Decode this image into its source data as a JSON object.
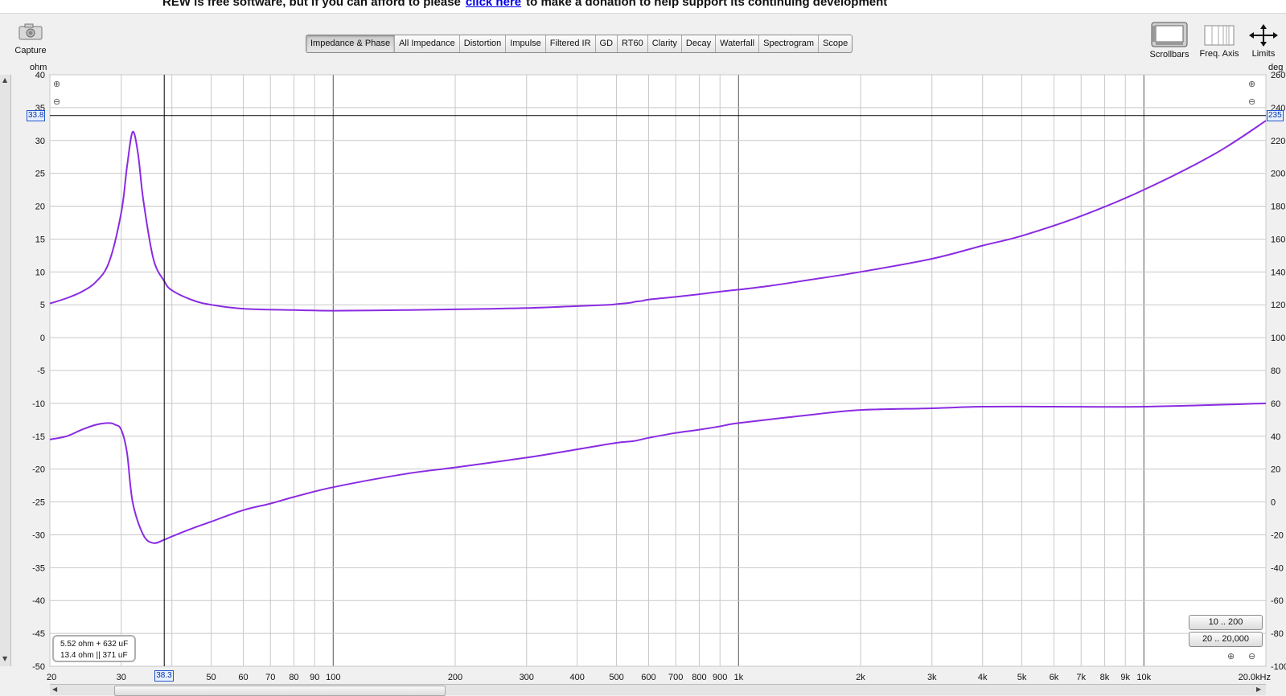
{
  "banner": {
    "prefix": "REW is free software, but if you can afford to please",
    "link": "click here",
    "suffix": "to make a donation to help support its continuing development"
  },
  "toolbar": {
    "capture_label": "Capture",
    "scrollbars_label": "Scrollbars",
    "freq_axis_label": "Freq. Axis",
    "limits_label": "Limits"
  },
  "tabs": [
    {
      "label": "Impedance & Phase",
      "active": true
    },
    {
      "label": "All Impedance"
    },
    {
      "label": "Distortion"
    },
    {
      "label": "Impulse"
    },
    {
      "label": "Filtered IR"
    },
    {
      "label": "GD"
    },
    {
      "label": "RT60"
    },
    {
      "label": "Clarity"
    },
    {
      "label": "Decay"
    },
    {
      "label": "Waterfall"
    },
    {
      "label": "Spectrogram"
    },
    {
      "label": "Scope"
    }
  ],
  "axes": {
    "left_unit": "ohm",
    "right_unit": "deg",
    "left_ticks": [
      "40",
      "35",
      "30",
      "25",
      "20",
      "15",
      "10",
      "5",
      "0",
      "-5",
      "-10",
      "-15",
      "-20",
      "-25",
      "-30",
      "-35",
      "-40",
      "-45",
      "-50"
    ],
    "right_ticks": [
      "260",
      "240",
      "220",
      "200",
      "180",
      "160",
      "140",
      "120",
      "100",
      "80",
      "60",
      "40",
      "20",
      "0",
      "-20",
      "-40",
      "-60",
      "-80",
      "-100"
    ],
    "freq_ticks": [
      "20",
      "30",
      "50",
      "60",
      "70",
      "80",
      "90",
      "100",
      "200",
      "300",
      "400",
      "500",
      "600",
      "700",
      "800",
      "900",
      "1k",
      "2k",
      "3k",
      "4k",
      "5k",
      "6k",
      "7k",
      "8k",
      "9k",
      "10k",
      "20.0kHz"
    ]
  },
  "cursor": {
    "freq_label": "38.3",
    "left_value_label": "33.8",
    "right_value_label": "235"
  },
  "legend": {
    "line1": "5.52 ohm + 632 uF",
    "line2": "13.4 ohm || 371 uF"
  },
  "range_buttons": {
    "low": "10 .. 200",
    "high": "20 .. 20,000"
  },
  "colors": {
    "trace": "#8a2be2",
    "grid": "#c8c8c8",
    "cursor": "#000000"
  },
  "chart_data": {
    "type": "line",
    "x_scale": "log",
    "xlim": [
      20,
      20000
    ],
    "ylim_left": [
      -50,
      40
    ],
    "ylim_right": [
      -100,
      260
    ],
    "series": [
      {
        "axis": "left",
        "x": [
          20,
          22,
          24,
          26,
          28,
          30,
          31,
          32,
          33,
          34,
          36,
          38.3,
          40,
          45,
          50,
          60,
          80,
          100,
          150,
          200,
          300,
          400,
          480,
          500,
          520,
          540,
          560,
          580,
          600,
          700,
          800,
          900,
          1000,
          1200,
          1500,
          2000,
          3000,
          4000,
          5000,
          7000,
          10000,
          15000,
          20000
        ],
        "y": [
          5.2,
          6,
          7,
          8.5,
          11.5,
          19,
          26,
          31.3,
          28,
          21,
          12,
          8.6,
          7.2,
          5.7,
          5,
          4.4,
          4.2,
          4.1,
          4.2,
          4.3,
          4.5,
          4.8,
          5,
          5.1,
          5.2,
          5.3,
          5.5,
          5.6,
          5.8,
          6.2,
          6.6,
          7,
          7.3,
          7.9,
          8.8,
          10,
          12,
          14,
          15.5,
          18.5,
          22.5,
          28,
          33
        ]
      },
      {
        "axis": "right",
        "x": [
          20,
          22,
          24,
          26,
          28,
          29,
          30,
          31,
          32,
          34,
          36,
          38.3,
          40,
          45,
          50,
          60,
          70,
          80,
          100,
          150,
          200,
          300,
          400,
          500,
          550,
          600,
          700,
          800,
          900,
          1000,
          1500,
          2000,
          3000,
          4000,
          6000,
          10000,
          20000
        ],
        "y": [
          38,
          40,
          44,
          47,
          48,
          47,
          44,
          30,
          0,
          -20,
          -25,
          -23,
          -21,
          -16,
          -12,
          -5,
          -1,
          3,
          9,
          17,
          21,
          27,
          32,
          36,
          37,
          39,
          42,
          44,
          46,
          48,
          53,
          56,
          57,
          58,
          58,
          58,
          60
        ]
      }
    ]
  }
}
